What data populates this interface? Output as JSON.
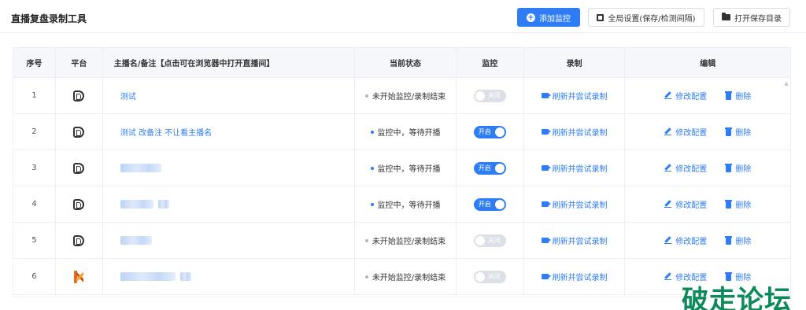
{
  "header": {
    "title": "直播复盘录制工具",
    "add_monitor_label": "添加监控",
    "global_settings_label": "全局设置(保存/检测间隔)",
    "open_dir_label": "打开保存目录"
  },
  "table": {
    "columns": [
      "序号",
      "平台",
      "主播名/备注【点击可在浏览器中打开直播间】",
      "当前状态",
      "监控",
      "录制",
      "编辑"
    ],
    "record_action_label": "刷新并尝试录制",
    "edit_label": "修改配置",
    "delete_label": "删除",
    "rows": [
      {
        "index": "1",
        "platform": "douyin",
        "name": "测试",
        "name_blurred": false,
        "status": "未开始监控/录制结束",
        "monitoring": false,
        "toggle_text": "关闭"
      },
      {
        "index": "2",
        "platform": "douyin",
        "name": "测试 改备注 不让看主播名",
        "name_blurred": false,
        "status": "监控中，等待开播",
        "monitoring": true,
        "toggle_text": "开启"
      },
      {
        "index": "3",
        "platform": "douyin",
        "name": "",
        "name_blurred": true,
        "status": "监控中，等待开播",
        "monitoring": true,
        "toggle_text": "开启"
      },
      {
        "index": "4",
        "platform": "douyin",
        "name": "",
        "name_blurred": true,
        "status": "监控中，等待开播",
        "monitoring": true,
        "toggle_text": "开启"
      },
      {
        "index": "5",
        "platform": "douyin",
        "name": "",
        "name_blurred": true,
        "status": "未开始监控/录制结束",
        "monitoring": false,
        "toggle_text": "关闭"
      },
      {
        "index": "6",
        "platform": "kuaishou",
        "name": "",
        "name_blurred": true,
        "status": "未开始监控/录制结束",
        "monitoring": false,
        "toggle_text": "关闭"
      }
    ]
  },
  "watermark": "破走论坛",
  "colors": {
    "accent": "#2f7df6",
    "watermark": "#0d8a5a",
    "kuaishou": "#e06a2a"
  }
}
